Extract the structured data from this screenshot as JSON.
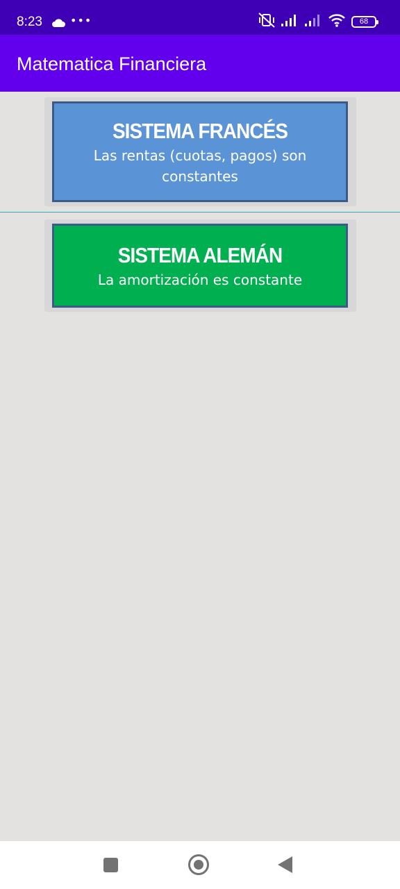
{
  "status_bar": {
    "time": "8:23",
    "battery_level": "68",
    "icons": [
      "cloud-icon",
      "more-dots-icon",
      "vibrate-off-icon",
      "signal-icon",
      "signal-icon",
      "wifi-icon",
      "battery-icon"
    ]
  },
  "app_bar": {
    "title": "Matematica Financiera"
  },
  "cards": [
    {
      "heading": "SISTEMA FRANCÉS",
      "subtitle": "Las rentas (cuotas, pagos) son constantes"
    },
    {
      "heading": "SISTEMA ALEMÁN",
      "subtitle": "La amortización es constante"
    }
  ],
  "nav_bar": {
    "icons": [
      "recents-square-icon",
      "home-circle-icon",
      "back-triangle-icon"
    ]
  },
  "colors": {
    "status_bar": "#3f00b5",
    "app_bar": "#6200ee",
    "background": "#e3e2e1",
    "french_card": "#5b93d7",
    "german_card": "#00b050",
    "divider": "#34a6bd"
  }
}
